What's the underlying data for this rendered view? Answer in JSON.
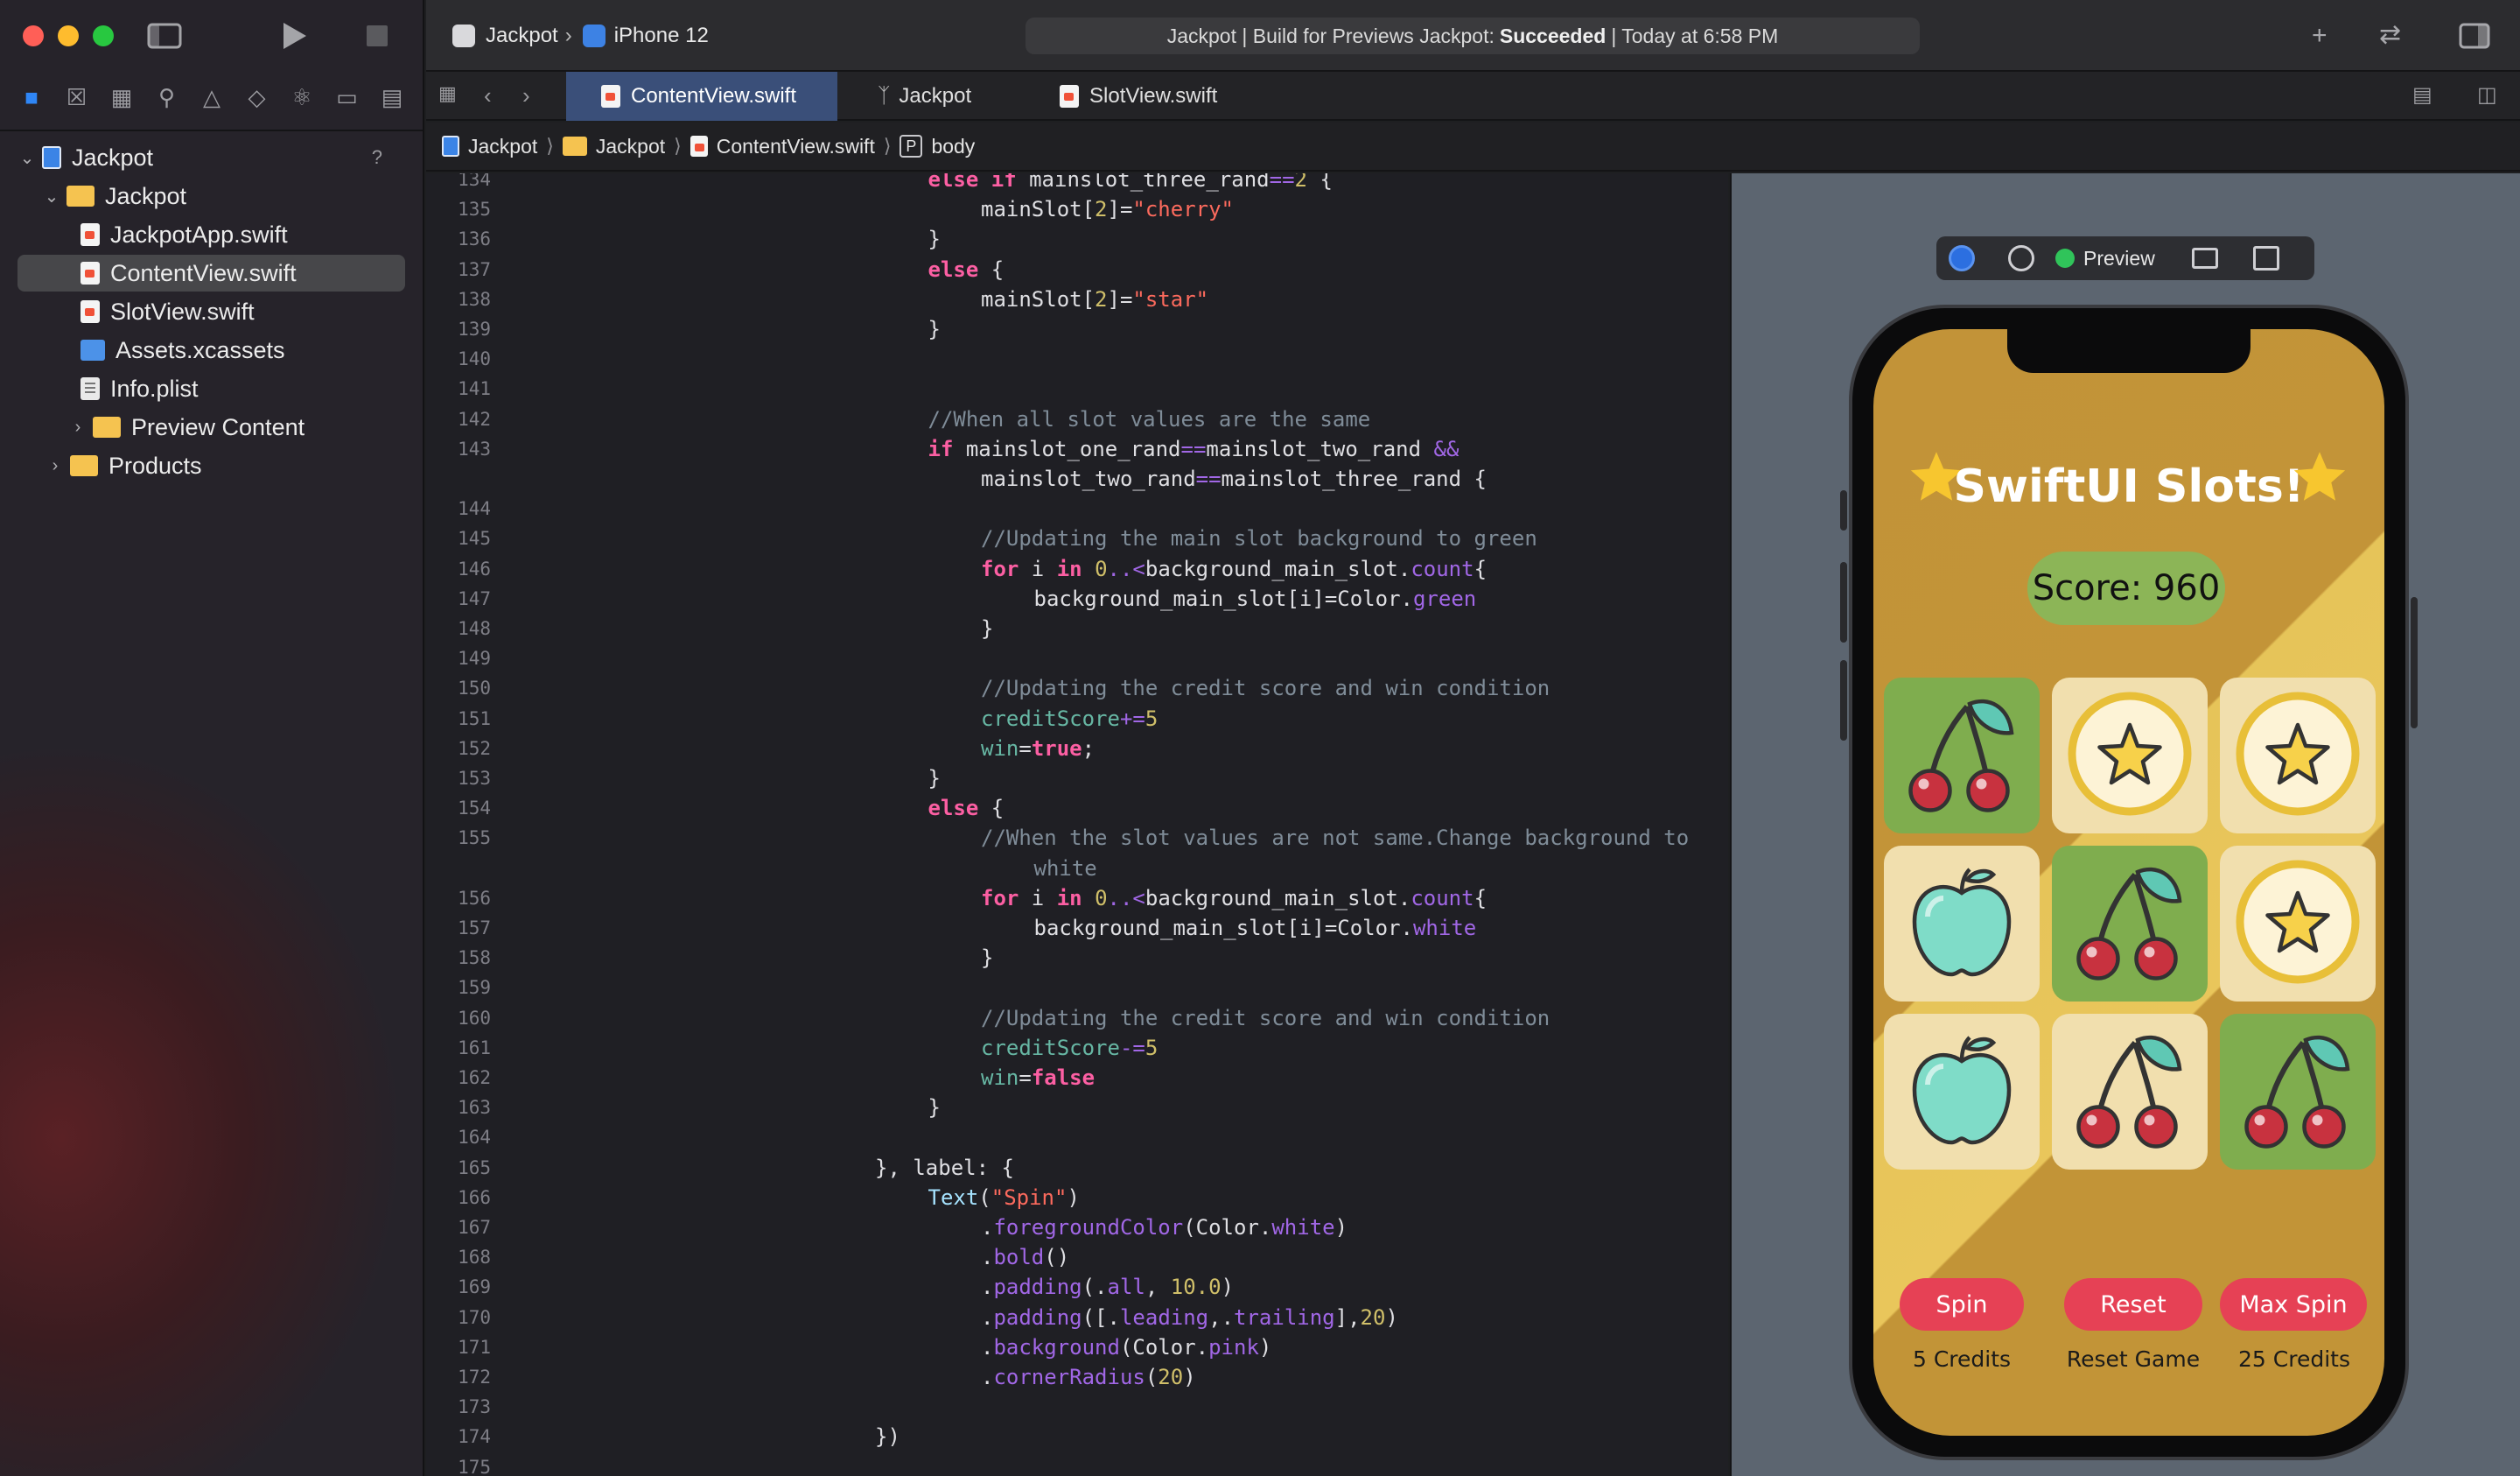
{
  "window": {
    "scheme_project": "Jackpot",
    "scheme_device": "iPhone 12",
    "status_prefix": "Jackpot | Build for Previews Jackpot:",
    "status_result": "Succeeded",
    "status_suffix": "| Today at 6:58 PM"
  },
  "navigator": {
    "icons": [
      "folder-icon",
      "source-control-icon",
      "symbol-icon",
      "find-icon",
      "issue-icon",
      "test-icon",
      "debug-icon",
      "breakpoint-icon",
      "report-icon"
    ],
    "project": "Jackpot",
    "badge": "?",
    "group": "Jackpot",
    "files": [
      "JackpotApp.swift",
      "ContentView.swift",
      "SlotView.swift",
      "Assets.xcassets",
      "Info.plist"
    ],
    "subgroup": "Preview Content",
    "products": "Products"
  },
  "tabs": [
    "ContentView.swift",
    "Jackpot",
    "SlotView.swift"
  ],
  "breadcrumb": [
    "Jackpot",
    "Jackpot",
    "ContentView.swift",
    "body"
  ],
  "breadcrumb_badge": "P",
  "code": {
    "lines": [
      {
        "n": "134",
        "t": [
          [
            "kw",
            "else if "
          ],
          [
            "op",
            "mainslot_three_rand"
          ],
          [
            "fn",
            "=="
          ],
          [
            "num",
            "2"
          ],
          [
            "op",
            " {"
          ]
        ],
        "i": 7
      },
      {
        "n": "135",
        "t": [
          [
            "op",
            "mainSlot["
          ],
          [
            "num",
            "2"
          ],
          [
            "op",
            "]="
          ],
          [
            "str",
            "\"cherry\""
          ]
        ],
        "i": 8
      },
      {
        "n": "136",
        "t": [
          [
            "op",
            "}"
          ]
        ],
        "i": 7
      },
      {
        "n": "137",
        "t": [
          [
            "kw",
            "else"
          ],
          [
            "op",
            " {"
          ]
        ],
        "i": 7
      },
      {
        "n": "138",
        "t": [
          [
            "op",
            "mainSlot["
          ],
          [
            "num",
            "2"
          ],
          [
            "op",
            "]="
          ],
          [
            "str",
            "\"star\""
          ]
        ],
        "i": 8
      },
      {
        "n": "139",
        "t": [
          [
            "op",
            "}"
          ]
        ],
        "i": 7
      },
      {
        "n": "140",
        "t": [],
        "i": 0
      },
      {
        "n": "141",
        "t": [],
        "i": 0
      },
      {
        "n": "142",
        "t": [
          [
            "cm",
            "//When all slot values are the same"
          ]
        ],
        "i": 7
      },
      {
        "n": "143",
        "t": [
          [
            "kw",
            "if "
          ],
          [
            "op",
            "mainslot_one_rand"
          ],
          [
            "fn",
            "=="
          ],
          [
            "op",
            "mainslot_two_rand "
          ],
          [
            "fn",
            "&&"
          ]
        ],
        "i": 7
      },
      {
        "n": "",
        "t": [
          [
            "op",
            "mainslot_two_rand"
          ],
          [
            "fn",
            "=="
          ],
          [
            "op",
            "mainslot_three_rand {"
          ]
        ],
        "i": 8
      },
      {
        "n": "144",
        "t": [],
        "i": 0
      },
      {
        "n": "145",
        "t": [
          [
            "cm",
            "//Updating the main slot background to green"
          ]
        ],
        "i": 8
      },
      {
        "n": "146",
        "t": [
          [
            "kw",
            "for "
          ],
          [
            "op",
            "i "
          ],
          [
            "kw",
            "in "
          ],
          [
            "num",
            "0"
          ],
          [
            "fn",
            "..<"
          ],
          [
            "op",
            "background_main_slot."
          ],
          [
            "fn",
            "count"
          ],
          [
            "op",
            "{"
          ]
        ],
        "i": 8
      },
      {
        "n": "147",
        "t": [
          [
            "op",
            "background_main_slot[i]="
          ],
          [
            "op",
            "Color."
          ],
          [
            "fn",
            "green"
          ]
        ],
        "i": 9
      },
      {
        "n": "148",
        "t": [
          [
            "op",
            "}"
          ]
        ],
        "i": 8
      },
      {
        "n": "149",
        "t": [],
        "i": 0
      },
      {
        "n": "150",
        "t": [
          [
            "cm",
            "//Updating the credit score and win condition"
          ]
        ],
        "i": 8
      },
      {
        "n": "151",
        "t": [
          [
            "pr",
            "creditScore"
          ],
          [
            "fn",
            "+="
          ],
          [
            "num",
            "5"
          ]
        ],
        "i": 8
      },
      {
        "n": "152",
        "t": [
          [
            "pr",
            "win"
          ],
          [
            "op",
            "="
          ],
          [
            "kw",
            "true"
          ],
          [
            "op",
            ";"
          ]
        ],
        "i": 8
      },
      {
        "n": "153",
        "t": [
          [
            "op",
            "}"
          ]
        ],
        "i": 7
      },
      {
        "n": "154",
        "t": [
          [
            "kw",
            "else"
          ],
          [
            "op",
            " {"
          ]
        ],
        "i": 7
      },
      {
        "n": "155",
        "t": [
          [
            "cm",
            "//When the slot values are not same.Change background to"
          ]
        ],
        "i": 8
      },
      {
        "n": "",
        "t": [
          [
            "cm",
            "white"
          ]
        ],
        "i": 9
      },
      {
        "n": "156",
        "t": [
          [
            "kw",
            "for "
          ],
          [
            "op",
            "i "
          ],
          [
            "kw",
            "in "
          ],
          [
            "num",
            "0"
          ],
          [
            "fn",
            "..<"
          ],
          [
            "op",
            "background_main_slot."
          ],
          [
            "fn",
            "count"
          ],
          [
            "op",
            "{"
          ]
        ],
        "i": 8
      },
      {
        "n": "157",
        "t": [
          [
            "op",
            "background_main_slot[i]="
          ],
          [
            "op",
            "Color."
          ],
          [
            "fn",
            "white"
          ]
        ],
        "i": 9
      },
      {
        "n": "158",
        "t": [
          [
            "op",
            "}"
          ]
        ],
        "i": 8
      },
      {
        "n": "159",
        "t": [],
        "i": 0
      },
      {
        "n": "160",
        "t": [
          [
            "cm",
            "//Updating the credit score and win condition"
          ]
        ],
        "i": 8
      },
      {
        "n": "161",
        "t": [
          [
            "pr",
            "creditScore"
          ],
          [
            "fn",
            "-="
          ],
          [
            "num",
            "5"
          ]
        ],
        "i": 8
      },
      {
        "n": "162",
        "t": [
          [
            "pr",
            "win"
          ],
          [
            "op",
            "="
          ],
          [
            "kw",
            "false"
          ]
        ],
        "i": 8
      },
      {
        "n": "163",
        "t": [
          [
            "op",
            "}"
          ]
        ],
        "i": 7
      },
      {
        "n": "164",
        "t": [],
        "i": 0
      },
      {
        "n": "165",
        "t": [
          [
            "op",
            "}, label: {"
          ]
        ],
        "i": 6
      },
      {
        "n": "166",
        "t": [
          [
            "ty",
            "Text"
          ],
          [
            "op",
            "("
          ],
          [
            "str",
            "\"Spin\""
          ],
          [
            "op",
            ")"
          ]
        ],
        "i": 7
      },
      {
        "n": "167",
        "t": [
          [
            "op",
            "."
          ],
          [
            "fn",
            "foregroundColor"
          ],
          [
            "op",
            "(Color."
          ],
          [
            "fn",
            "white"
          ],
          [
            "op",
            ")"
          ]
        ],
        "i": 8
      },
      {
        "n": "168",
        "t": [
          [
            "op",
            "."
          ],
          [
            "fn",
            "bold"
          ],
          [
            "op",
            "()"
          ]
        ],
        "i": 8
      },
      {
        "n": "169",
        "t": [
          [
            "op",
            "."
          ],
          [
            "fn",
            "padding"
          ],
          [
            "op",
            "(."
          ],
          [
            "fn",
            "all"
          ],
          [
            "op",
            ", "
          ],
          [
            "num",
            "10.0"
          ],
          [
            "op",
            ")"
          ]
        ],
        "i": 8
      },
      {
        "n": "170",
        "t": [
          [
            "op",
            "."
          ],
          [
            "fn",
            "padding"
          ],
          [
            "op",
            "([."
          ],
          [
            "fn",
            "leading"
          ],
          [
            "op",
            ",."
          ],
          [
            "fn",
            "trailing"
          ],
          [
            "op",
            "],"
          ],
          [
            "num",
            "20"
          ],
          [
            "op",
            ")"
          ]
        ],
        "i": 8
      },
      {
        "n": "171",
        "t": [
          [
            "op",
            "."
          ],
          [
            "fn",
            "background"
          ],
          [
            "op",
            "(Color."
          ],
          [
            "fn",
            "pink"
          ],
          [
            "op",
            ")"
          ]
        ],
        "i": 8
      },
      {
        "n": "172",
        "t": [
          [
            "op",
            "."
          ],
          [
            "fn",
            "cornerRadius"
          ],
          [
            "op",
            "("
          ],
          [
            "num",
            "20"
          ],
          [
            "op",
            ")"
          ]
        ],
        "i": 8
      },
      {
        "n": "173",
        "t": [],
        "i": 0
      },
      {
        "n": "174",
        "t": [
          [
            "op",
            "})"
          ]
        ],
        "i": 6
      },
      {
        "n": "175",
        "t": [],
        "i": 0
      }
    ]
  },
  "preview": {
    "label": "Preview",
    "app_title": "SwiftUI Slots!",
    "score_text": "Score: 960",
    "slots": [
      {
        "symbol": "cherry",
        "win": true
      },
      {
        "symbol": "star",
        "win": false
      },
      {
        "symbol": "star",
        "win": false
      },
      {
        "symbol": "apple",
        "win": false
      },
      {
        "symbol": "cherry",
        "win": true
      },
      {
        "symbol": "star",
        "win": false
      },
      {
        "symbol": "apple",
        "win": false
      },
      {
        "symbol": "cherry",
        "win": false
      },
      {
        "symbol": "cherry",
        "win": true
      }
    ],
    "buttons": [
      {
        "label": "Spin",
        "caption": "5 Credits"
      },
      {
        "label": "Reset",
        "caption": "Reset Game"
      },
      {
        "label": "Max Spin",
        "caption": "25 Credits"
      }
    ]
  },
  "colors": {
    "accent": "#3a4f79",
    "button_pink": "#e64155",
    "win_green": "#7fad4e",
    "score_green": "#8cb557"
  }
}
